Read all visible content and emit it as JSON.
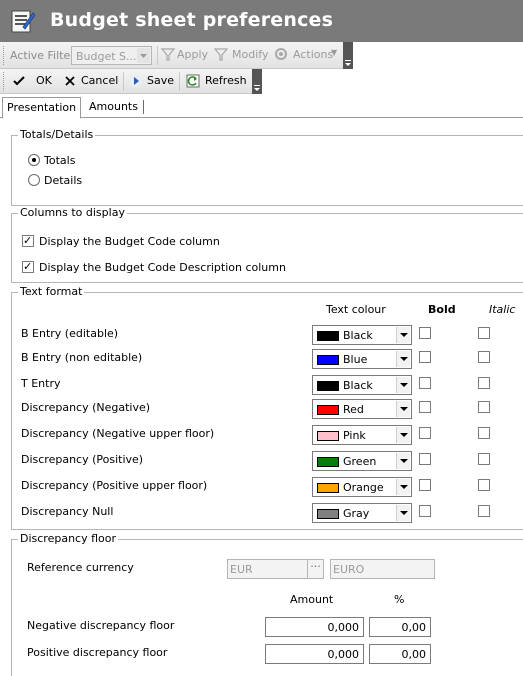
{
  "window": {
    "title": "Budget sheet preferences"
  },
  "toolbar1": {
    "active_filter_label": "Active Filter",
    "active_filter_value": "Budget S...",
    "apply_label": "Apply",
    "modify_label": "Modify",
    "actions_label": "Actions"
  },
  "toolbar2": {
    "ok_label": "OK",
    "cancel_label": "Cancel",
    "save_label": "Save",
    "refresh_label": "Refresh"
  },
  "tabs": [
    {
      "label": "Presentation",
      "active": true
    },
    {
      "label": "Amounts",
      "active": false
    }
  ],
  "totals_details": {
    "title": "Totals/Details",
    "options": [
      {
        "label": "Totals",
        "checked": true
      },
      {
        "label": "Details",
        "checked": false
      }
    ]
  },
  "columns": {
    "title": "Columns to display",
    "items": [
      {
        "label": "Display the Budget Code column",
        "checked": true
      },
      {
        "label": "Display the Budget Code Description column",
        "checked": true
      }
    ]
  },
  "text_format": {
    "title": "Text format",
    "col_colour": "Text colour",
    "col_bold": "Bold",
    "col_italic": "Italic",
    "rows": [
      {
        "label": "B Entry (editable)",
        "colour_name": "Black",
        "colour": "#000000",
        "bold": false,
        "italic": false
      },
      {
        "label": "B Entry (non editable)",
        "colour_name": "Blue",
        "colour": "#0000ff",
        "bold": false,
        "italic": false
      },
      {
        "label": "T Entry",
        "colour_name": "Black",
        "colour": "#000000",
        "bold": false,
        "italic": false
      },
      {
        "label": "Discrepancy (Negative)",
        "colour_name": "Red",
        "colour": "#ff0000",
        "bold": false,
        "italic": false
      },
      {
        "label": "Discrepancy (Negative upper floor)",
        "colour_name": "Pink",
        "colour": "#ffc0cb",
        "bold": false,
        "italic": false
      },
      {
        "label": "Discrepancy (Positive)",
        "colour_name": "Green",
        "colour": "#008000",
        "bold": false,
        "italic": false
      },
      {
        "label": "Discrepancy (Positive upper floor)",
        "colour_name": "Orange",
        "colour": "#ffa500",
        "bold": false,
        "italic": false
      },
      {
        "label": "Discrepancy Null",
        "colour_name": "Gray",
        "colour": "#808080",
        "bold": false,
        "italic": false
      }
    ]
  },
  "discrepancy_floor": {
    "title": "Discrepancy floor",
    "reference_currency_label": "Reference currency",
    "currency_code": "EUR",
    "currency_name": "EURO",
    "col_amount": "Amount",
    "col_percent": "%",
    "negative_label": "Negative discrepancy floor",
    "negative_amount": "0,000",
    "negative_percent": "0,00",
    "positive_label": "Positive discrepancy floor",
    "positive_amount": "0,000",
    "positive_percent": "0,00"
  }
}
